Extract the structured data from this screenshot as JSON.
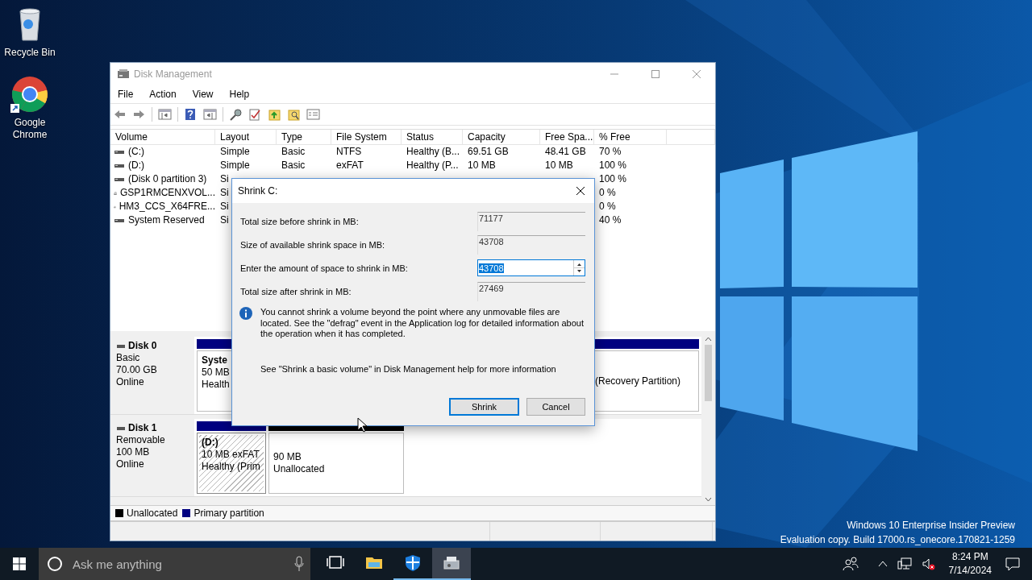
{
  "desktop_icons": [
    {
      "kind": "recycle",
      "label": "Recycle Bin"
    },
    {
      "kind": "browser",
      "label": "Google Chrome"
    }
  ],
  "window": {
    "title": "Disk Management",
    "menu": [
      "File",
      "Action",
      "View",
      "Help"
    ],
    "table": {
      "columns": [
        "Volume",
        "Layout",
        "Type",
        "File System",
        "Status",
        "Capacity",
        "Free Spa...",
        "% Free"
      ],
      "rows": [
        {
          "kind": "disk",
          "volume": "(C:)",
          "layout": "Simple",
          "type": "Basic",
          "file_system": "NTFS",
          "status": "Healthy (B...",
          "capacity": "69.51 GB",
          "free_space": "48.41 GB",
          "percent_free": "70 %"
        },
        {
          "kind": "disk",
          "volume": "(D:)",
          "layout": "Simple",
          "type": "Basic",
          "file_system": "exFAT",
          "status": "Healthy (P...",
          "capacity": "10 MB",
          "free_space": "10 MB",
          "percent_free": "100 %"
        },
        {
          "kind": "disk",
          "volume": "(Disk 0 partition 3)",
          "layout": "Si",
          "percent_free": "100 %"
        },
        {
          "kind": "disc",
          "volume": "GSP1RMCENXVOL...",
          "layout": "Si",
          "percent_free": "0 %"
        },
        {
          "kind": "disc",
          "volume": "HM3_CCS_X64FRE...",
          "layout": "Si",
          "percent_free": "0 %"
        },
        {
          "kind": "disk",
          "volume": "System Reserved",
          "layout": "Si",
          "percent_free": "40 %"
        }
      ]
    },
    "disks": [
      {
        "name": "Disk 0",
        "details": [
          "Basic",
          "70.00 GB",
          "Online"
        ],
        "partitions": [
          {
            "kind": "primary",
            "name": "Syste",
            "lines": [
              "50 MB",
              "Health"
            ],
            "selected": false
          },
          {
            "kind": "primary",
            "lines": [
              "(Recovery Partition)"
            ],
            "selected": false
          }
        ]
      },
      {
        "name": "Disk 1",
        "details": [
          "Removable",
          "100 MB",
          "Online"
        ],
        "partitions": [
          {
            "kind": "primary",
            "name": "(D:)",
            "lines": [
              "10 MB exFAT",
              "Healthy (Prim"
            ],
            "selected": true
          },
          {
            "kind": "unallocated",
            "lines": [
              "90 MB",
              "Unallocated"
            ],
            "selected": false
          }
        ]
      }
    ],
    "legend": [
      {
        "label": "Unallocated",
        "color": "#000000"
      },
      {
        "label": "Primary partition",
        "color": "#000080"
      }
    ]
  },
  "dialog": {
    "title": "Shrink C:",
    "fields": [
      {
        "kind": "readonly",
        "label": "Total size before shrink in MB:",
        "value": "71177"
      },
      {
        "kind": "readonly",
        "label": "Size of available shrink space in MB:",
        "value": "43708"
      },
      {
        "kind": "spin",
        "label": "Enter the amount of space to shrink in MB:",
        "value": "43708",
        "text_selected": true
      },
      {
        "kind": "readonly",
        "label": "Total size after shrink in MB:",
        "value": "27469"
      }
    ],
    "info": "You cannot shrink a volume beyond the point where any unmovable files are located. See the \"defrag\" event in the Application log for detailed information about the operation when it has completed.",
    "help": "See \"Shrink a basic volume\" in Disk Management help for more information",
    "buttons": [
      {
        "label": "Shrink",
        "default": true
      },
      {
        "label": "Cancel",
        "default": false
      }
    ]
  },
  "watermark": [
    "Windows 10 Enterprise Insider Preview",
    "Evaluation copy. Build 17000.rs_onecore.170821-1259"
  ],
  "taskbar": {
    "search_placeholder": "Ask me anything",
    "apps": [
      {
        "kind": "task_view",
        "running": false,
        "active": false
      },
      {
        "kind": "explorer",
        "running": false,
        "active": false
      },
      {
        "kind": "shield",
        "running": true,
        "active": false
      },
      {
        "kind": "disk",
        "running": true,
        "active": true
      }
    ],
    "time": "8:24 PM",
    "date": "7/14/2024"
  }
}
